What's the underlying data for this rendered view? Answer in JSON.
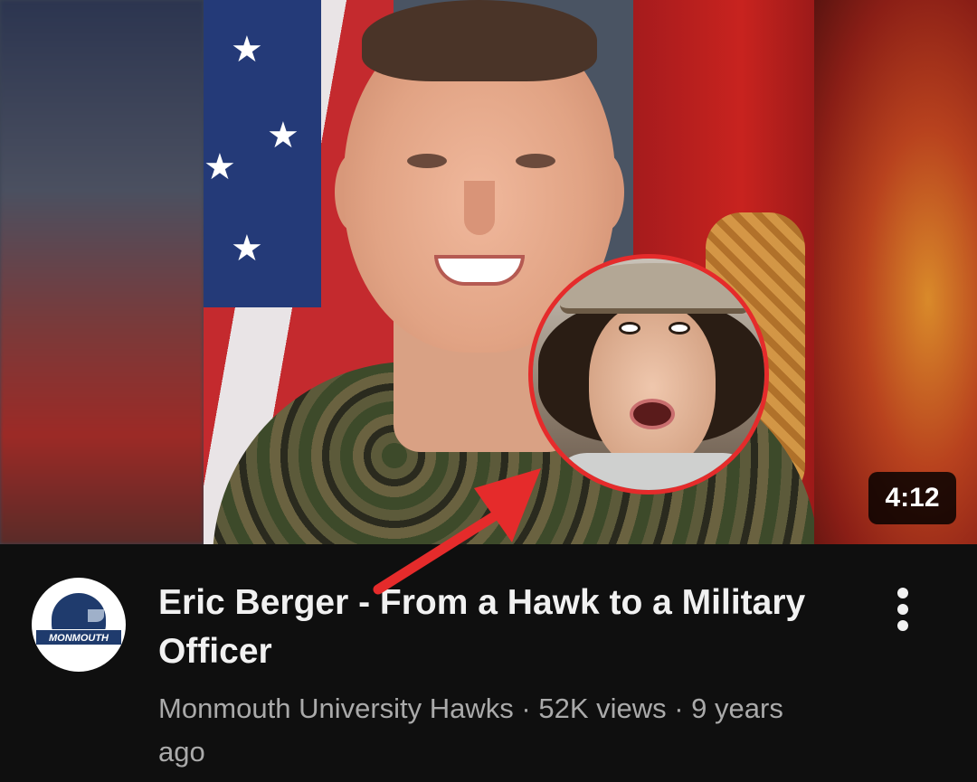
{
  "video": {
    "duration": "4:12",
    "title": "Eric Berger - From a Hawk to a Military Officer",
    "meta": "Monmouth University Hawks · 52K views · 9 years ago",
    "channel": {
      "logo_text": "MONMOUTH",
      "avatar_icon": "hawk-logo-icon"
    },
    "menu_icon": "more-vertical-icon"
  },
  "colors": {
    "background": "#0f0f0f",
    "title_text": "#f1f1f1",
    "meta_text": "#aaaaaa",
    "annotation_red": "#e52b2b"
  }
}
